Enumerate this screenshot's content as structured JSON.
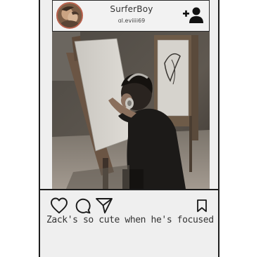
{
  "post": {
    "username": "SurferBoy",
    "handle": "ɑl.eviiii69",
    "caption": "Zack's so cute when he's focused"
  },
  "icons": {
    "follow": "add-user-icon",
    "like": "heart-icon",
    "comment": "comment-icon",
    "share": "send-icon",
    "save": "bookmark-icon"
  },
  "colors": {
    "avatar_ring": "#b8614d",
    "frame": "#1e1e1e",
    "background": "#efefef"
  }
}
